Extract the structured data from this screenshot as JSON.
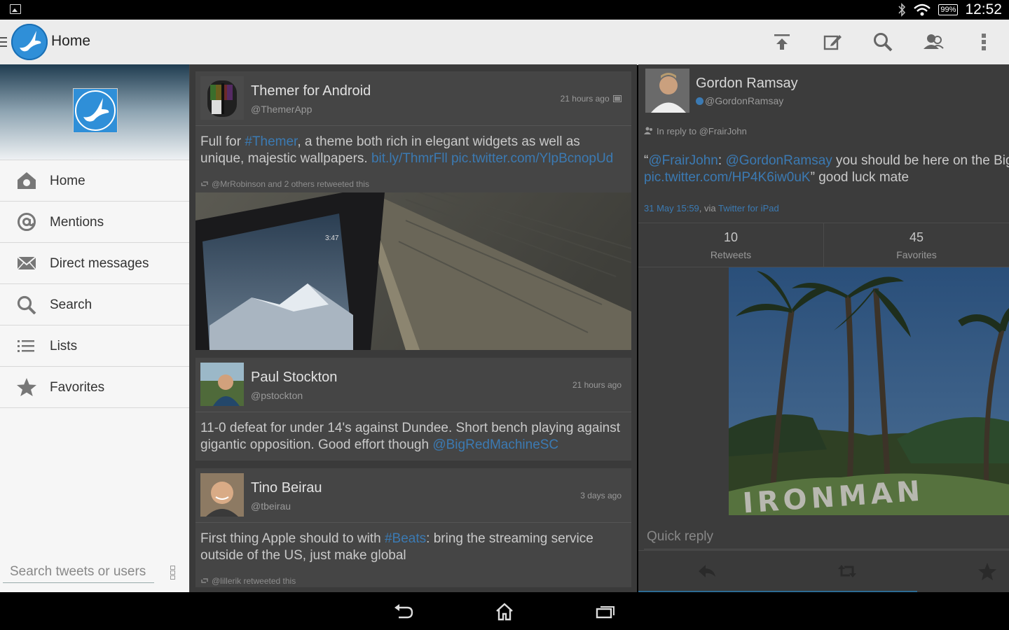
{
  "status_bar": {
    "battery": "99%",
    "time": "12:52"
  },
  "action_bar": {
    "title": "Home",
    "actions": [
      "upload-icon",
      "compose-icon",
      "search-icon",
      "people-icon",
      "overflow-menu-icon"
    ]
  },
  "nav": {
    "items": [
      {
        "label": "Home",
        "icon": "home-icon"
      },
      {
        "label": "Mentions",
        "icon": "at-icon"
      },
      {
        "label": "Direct messages",
        "icon": "envelope-icon"
      },
      {
        "label": "Search",
        "icon": "search-icon"
      },
      {
        "label": "Lists",
        "icon": "list-icon"
      },
      {
        "label": "Favorites",
        "icon": "star-icon"
      }
    ],
    "search_placeholder": "Search tweets or users"
  },
  "timeline": [
    {
      "name": "Themer for Android",
      "handle": "@ThemerApp",
      "time": "21 hours ago",
      "text_before": "Full for ",
      "hashtag": "#Themer",
      "text_mid": ", a theme both rich in elegant widgets as well as unique, majestic wallpapers. ",
      "links": "bit.ly/ThmrFll pic.twitter.com/YlpBcnopUd",
      "retweeted_by": "@MrRobinson and 2 others retweeted this",
      "photo_time": "3:47"
    },
    {
      "name": "Paul Stockton",
      "handle": "@pstockton",
      "time": "21 hours ago",
      "text": "11-0 defeat for under 14's against Dundee. Short bench playing against gigantic opposition. Good effort though ",
      "mention": "@BigRedMachineSC"
    },
    {
      "name": "Tino Beirau",
      "handle": "@tbeirau",
      "time": "3 days ago",
      "text_before": "First thing Apple should to with ",
      "hashtag": "#Beats",
      "text_after": ": bring the streaming service outside of the US, just make global",
      "retweeted_by": "@lillerik retweeted this"
    }
  ],
  "detail": {
    "name": "Gordon Ramsay",
    "handle": "@GordonRamsay",
    "in_reply_to": "In reply to @FrairJohn",
    "quote_open": "“",
    "mention1": "@FrairJohn",
    "colon": ": ",
    "mention2": "@GordonRamsay",
    "text1": " you should be here on the Big Island con",
    "pic_link": "pic.twitter.com/HP4K6iw0uK",
    "text2": "” good luck mate",
    "date": "31 May 15:59",
    "via": ", via ",
    "client": "Twitter for iPad",
    "retweets": "10",
    "retweets_label": "Retweets",
    "favorites": "45",
    "favorites_label": "Favorites",
    "photo_caption": "IRONMAN",
    "quick_reply_placeholder": "Quick reply"
  },
  "colors": {
    "accent": "#2f8fd8",
    "link": "#3b7ab3",
    "dim_overlay": "#3a3a3a"
  }
}
